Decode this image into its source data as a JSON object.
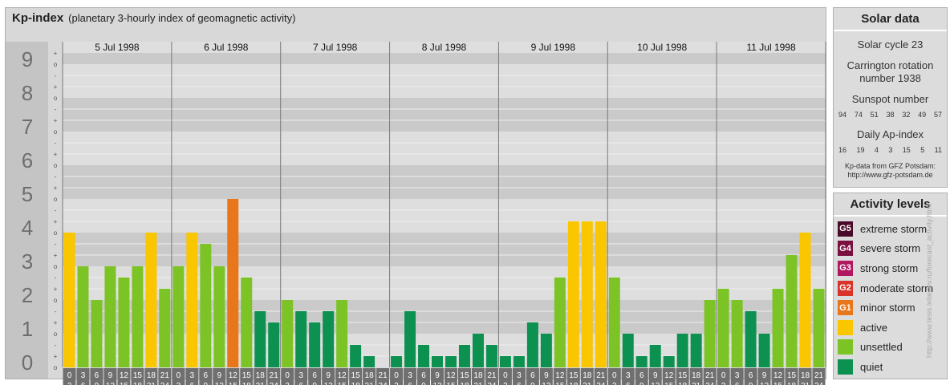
{
  "header": {
    "title": "Kp-index",
    "subtitle": "(planetary 3-hourly index of geomagnetic activity)"
  },
  "chart_data": {
    "type": "bar",
    "title": "Kp-index",
    "subtitle": "(planetary 3-hourly index of geomagnetic activity)",
    "ylim": [
      0,
      9
    ],
    "y_ticks": [
      "0",
      "1",
      "2",
      "3",
      "4",
      "5",
      "6",
      "7",
      "8",
      "9"
    ],
    "minor_labels": [
      "-",
      "o",
      "+"
    ],
    "days": [
      "5 Jul 1998",
      "6 Jul 1998",
      "7 Jul 1998",
      "8 Jul 1998",
      "9 Jul 1998",
      "10 Jul 1998",
      "11 Jul 1998"
    ],
    "interval_start": [
      "0",
      "3",
      "6",
      "9",
      "12",
      "15",
      "18",
      "21"
    ],
    "interval_end": [
      "3",
      "6",
      "9",
      "12",
      "15",
      "18",
      "21",
      "24"
    ],
    "values": [
      [
        4,
        3,
        2,
        3,
        2.667,
        3,
        4,
        2.333
      ],
      [
        3,
        4,
        3.667,
        3,
        5,
        2.667,
        1.667,
        1.333
      ],
      [
        2,
        1.667,
        1.333,
        1.667,
        2,
        0.667,
        0.333,
        0
      ],
      [
        0.333,
        1.667,
        0.667,
        0.333,
        0.333,
        0.667,
        1,
        0.667
      ],
      [
        0.333,
        0.333,
        1.333,
        1,
        2.667,
        4.333,
        4.333,
        4.333
      ],
      [
        2.667,
        1,
        0.333,
        0.667,
        0.333,
        1,
        1,
        2
      ],
      [
        2.333,
        2,
        1.667,
        1,
        2.333,
        3.333,
        4,
        2.333
      ]
    ],
    "colors": {
      "quiet": "#0c9150",
      "unsettled": "#7cc326",
      "active": "#f9c600",
      "g1": "#e8761a"
    }
  },
  "solar": {
    "title": "Solar data",
    "cycle": "Solar cycle 23",
    "carrington_l1": "Carrington rotation",
    "carrington_l2": "number 1938",
    "sunspot_title": "Sunspot number",
    "sunspot": [
      "94",
      "74",
      "51",
      "38",
      "32",
      "49",
      "57"
    ],
    "ap_title": "Daily Ap-index",
    "ap": [
      "16",
      "19",
      "4",
      "3",
      "15",
      "5",
      "11"
    ],
    "credit_l1": "Kp-data from GFZ Potsdam:",
    "credit_l2": "http://www.gfz-potsdam.de"
  },
  "levels": {
    "title": "Activity levels",
    "items": [
      {
        "badge": "G5",
        "label": "extreme storm",
        "color": "#4a0a2a"
      },
      {
        "badge": "G4",
        "label": "severe storm",
        "color": "#7a1040"
      },
      {
        "badge": "G3",
        "label": "strong storm",
        "color": "#b01860"
      },
      {
        "badge": "G2",
        "label": "moderate storm",
        "color": "#d8342a"
      },
      {
        "badge": "G1",
        "label": "minor storm",
        "color": "#e8761a"
      },
      {
        "badge": "",
        "label": "active",
        "color": "#f9c600"
      },
      {
        "badge": "",
        "label": "unsettled",
        "color": "#7cc326"
      },
      {
        "badge": "",
        "label": "quiet",
        "color": "#0c9150"
      }
    ]
  },
  "watermark": "http://www.tesis.lebedev.ru/forecast_activity.html"
}
